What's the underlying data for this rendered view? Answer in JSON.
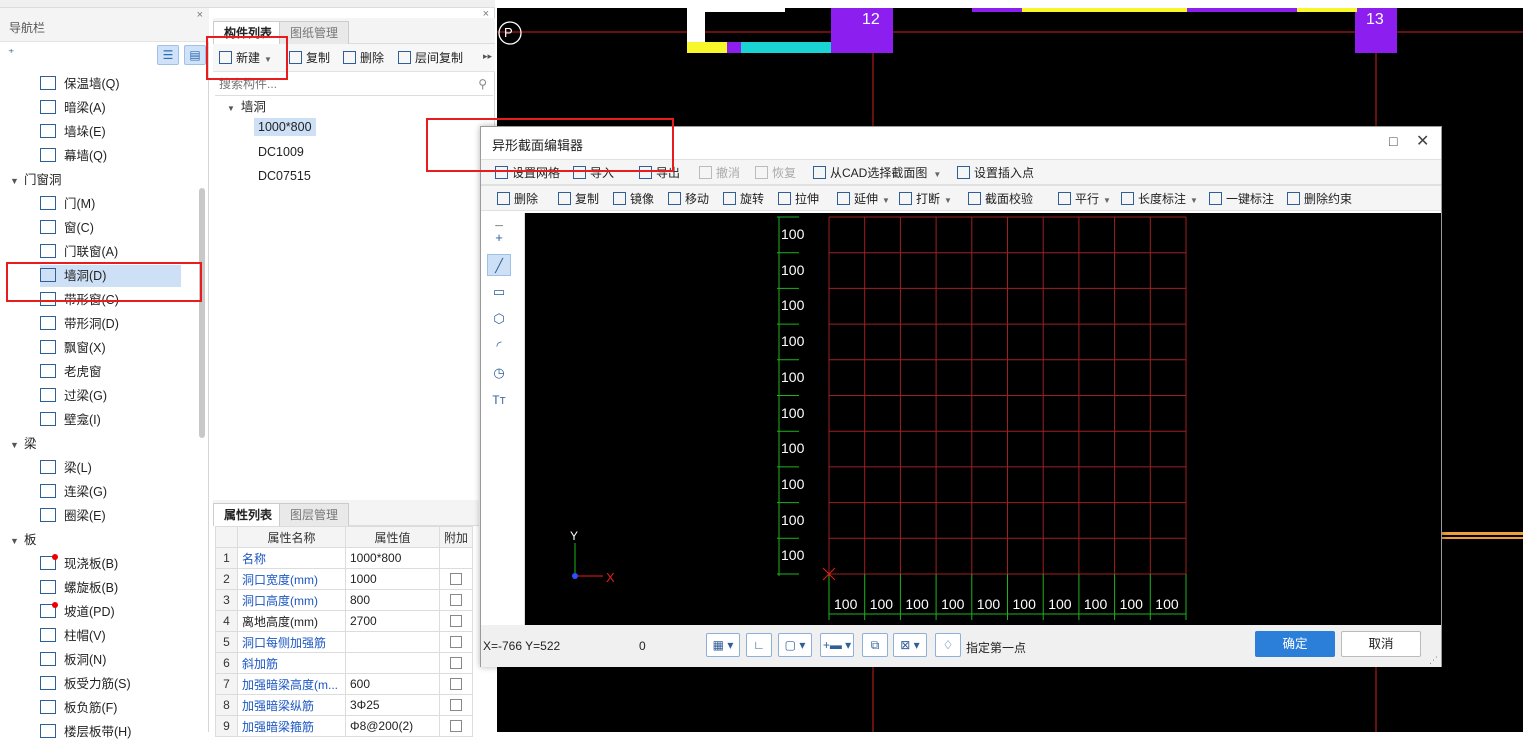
{
  "nav": {
    "title": "导航栏",
    "close": "×",
    "items": [
      {
        "label": "保温墙(Q)"
      },
      {
        "label": "暗梁(A)"
      },
      {
        "label": "墙垛(E)"
      },
      {
        "label": "幕墙(Q)"
      }
    ],
    "group_door": "门窗洞",
    "door_items": [
      {
        "label": "门(M)"
      },
      {
        "label": "窗(C)"
      },
      {
        "label": "门联窗(A)"
      },
      {
        "label": "墙洞(D)"
      },
      {
        "label": "带形窗(C)"
      },
      {
        "label": "带形洞(D)"
      },
      {
        "label": "飘窗(X)"
      },
      {
        "label": "老虎窗"
      },
      {
        "label": "过梁(G)"
      },
      {
        "label": "壁龛(I)"
      }
    ],
    "group_beam": "梁",
    "beam_items": [
      {
        "label": "梁(L)"
      },
      {
        "label": "连梁(G)"
      },
      {
        "label": "圈梁(E)"
      }
    ],
    "group_slab": "板",
    "slab_items": [
      {
        "label": "现浇板(B)"
      },
      {
        "label": "螺旋板(B)"
      },
      {
        "label": "坡道(PD)"
      },
      {
        "label": "柱帽(V)"
      },
      {
        "label": "板洞(N)"
      },
      {
        "label": "板受力筋(S)"
      },
      {
        "label": "板负筋(F)"
      },
      {
        "label": "楼层板带(H)"
      }
    ]
  },
  "comp": {
    "tab_list": "构件列表",
    "tab_drawing": "图纸管理",
    "close": "×",
    "tb_new": "新建",
    "tb_copy": "复制",
    "tb_delete": "删除",
    "tb_floor_copy": "层间复制",
    "search_placeholder": "搜索构件...",
    "tree_root": "墙洞",
    "tree_items": [
      "1000*800",
      "DC1009",
      "DC07515"
    ]
  },
  "props": {
    "tab_props": "属性列表",
    "tab_layers": "图层管理",
    "col_name": "属性名称",
    "col_value": "属性值",
    "col_extra": "附加",
    "rows": [
      {
        "n": "1",
        "k": "名称",
        "v": "1000*800"
      },
      {
        "n": "2",
        "k": "洞口宽度(mm)",
        "v": "1000"
      },
      {
        "n": "3",
        "k": "洞口高度(mm)",
        "v": "800"
      },
      {
        "n": "4",
        "k": "离地高度(mm)",
        "v": "2700"
      },
      {
        "n": "5",
        "k": "洞口每侧加强筋",
        "v": ""
      },
      {
        "n": "6",
        "k": "斜加筋",
        "v": ""
      },
      {
        "n": "7",
        "k": "加强暗梁高度(m...",
        "v": "600"
      },
      {
        "n": "8",
        "k": "加强暗梁纵筋",
        "v": "3Φ25"
      },
      {
        "n": "9",
        "k": "加强暗梁箍筋",
        "v": "Φ8@200(2)"
      }
    ]
  },
  "cad": {
    "axis_p": "P",
    "axis_12": "12",
    "axis_13": "13"
  },
  "dialog": {
    "title": "异形截面编辑器",
    "tb1": {
      "grid": "设置网格",
      "import": "导入",
      "export": "导出",
      "undo": "撤消",
      "redo": "恢复",
      "cad_select": "从CAD选择截面图",
      "insert_point": "设置插入点"
    },
    "tb2": {
      "delete": "删除",
      "copy": "复制",
      "mirror": "镜像",
      "move": "移动",
      "rotate": "旋转",
      "stretch": "拉伸",
      "extend": "延伸",
      "break": "打断",
      "check": "截面校验",
      "parallel": "平行",
      "length_dim": "长度标注",
      "auto_dim": "一键标注",
      "del_constraint": "删除约束"
    },
    "grid_labels_y": [
      "100",
      "100",
      "100",
      "100",
      "100",
      "100",
      "100",
      "100",
      "100",
      "100"
    ],
    "grid_labels_x": [
      "100",
      "100",
      "100",
      "100",
      "100",
      "100",
      "100",
      "100",
      "100",
      "100"
    ],
    "axis_x": "X",
    "axis_y": "Y",
    "coords": "X=-766 Y=522",
    "zero": "0",
    "prompt": "指定第一点",
    "ok": "确定",
    "cancel": "取消"
  },
  "colors": {
    "accent": "#2b7fd9",
    "highlight": "#e81c1c",
    "grid": "#a02020",
    "gridGreen": "#1db31d"
  }
}
